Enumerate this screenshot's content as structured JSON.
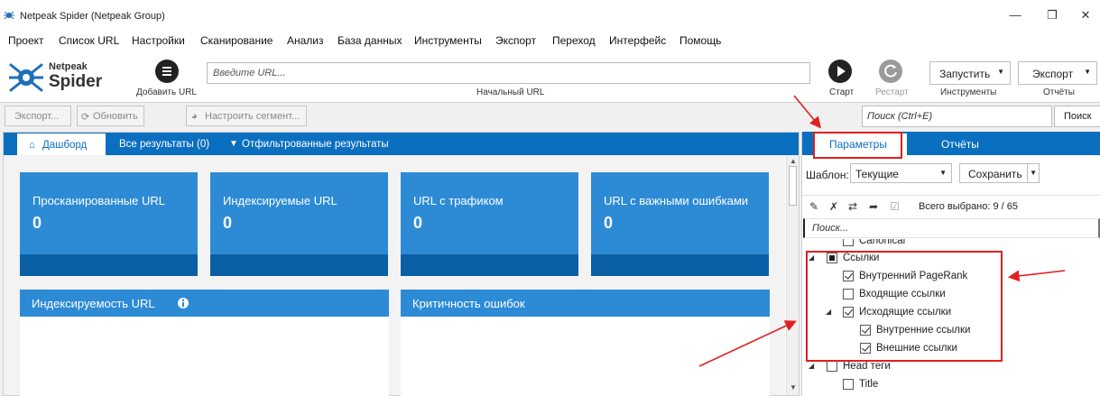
{
  "window": {
    "title": "Netpeak Spider (Netpeak Group)",
    "controls": {
      "minimize": "—",
      "restore": "❐",
      "close": "✕"
    }
  },
  "menu": [
    "Проект",
    "Список URL",
    "Настройки",
    "Сканирование",
    "Анализ",
    "База данных",
    "Инструменты",
    "Экспорт",
    "Переход",
    "Интерфейс",
    "Помощь"
  ],
  "toolbar": {
    "logo_top": "Netpeak",
    "logo_bottom": "Spider",
    "add_url_label": "Добавить URL",
    "url_placeholder": "Введите URL...",
    "start_url_caption": "Начальный URL",
    "start_label": "Старт",
    "restart_label": "Рестарт",
    "tools_button": "Запустить",
    "tools_caption": "Инструменты",
    "export_button": "Экспорт",
    "reports_caption": "Отчёты"
  },
  "subtoolbar": {
    "export_button": "Экспорт...",
    "refresh_button": "Обновить",
    "segment_button": "Настроить сегмент...",
    "search_placeholder": "Поиск (Ctrl+E)",
    "search_button": "Поиск"
  },
  "left_tabs": {
    "dashboard": "Дашборд",
    "all_results": "Все результаты (0)",
    "filtered": "Отфильтрованные результаты"
  },
  "tiles": [
    {
      "label": "Просканированные URL",
      "value": "0"
    },
    {
      "label": "Индексируемые URL",
      "value": "0"
    },
    {
      "label": "URL с трафиком",
      "value": "0"
    },
    {
      "label": "URL с важными ошибками",
      "value": "0"
    }
  ],
  "cards": {
    "indexability": "Индексируемость URL",
    "criticality": "Критичность ошибок"
  },
  "right_tabs": {
    "params": "Параметры",
    "reports": "Отчёты"
  },
  "template": {
    "label": "Шаблон:",
    "selected": "Текущие",
    "save_button": "Сохранить"
  },
  "selection": {
    "total": "Всего выбрано: 9 / 65"
  },
  "params_search_placeholder": "Поиск...",
  "tree": {
    "canonical": "Canonical",
    "links": "Ссылки",
    "internal_pagerank": "Внутренний PageRank",
    "incoming_links": "Входящие ссылки",
    "outgoing_links": "Исходящие ссылки",
    "internal_links": "Внутренние ссылки",
    "external_links": "Внешние ссылки",
    "head_tags": "Head теги",
    "title": "Title"
  },
  "colors": {
    "accent": "#0b6fc0",
    "tile": "#2d8bd6",
    "tile_band": "#0b5fa5",
    "annotation": "#e02020"
  }
}
